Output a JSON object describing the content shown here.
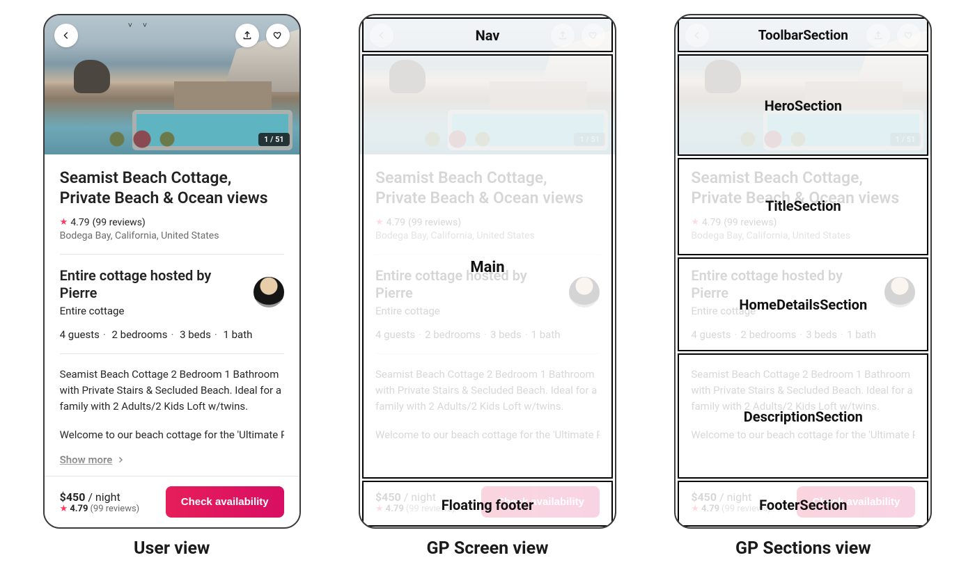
{
  "captions": {
    "user": "User view",
    "screen": "GP Screen view",
    "sections": "GP Sections view"
  },
  "hero": {
    "image_counter": "1 / 51"
  },
  "listing": {
    "title": "Seamist Beach Cottage, Private Beach & Ocean views",
    "rating": "4.79",
    "reviews": "(99 reviews)",
    "location": "Bodega Bay, California, United States"
  },
  "host": {
    "title": "Entire cottage hosted by Pierre",
    "subtitle": "Entire cottage"
  },
  "capacity": {
    "guests": "4 guests",
    "bedrooms": "2 bedrooms",
    "beds": "3 beds",
    "baths": "1 bath"
  },
  "description": {
    "p1": "Seamist Beach Cottage 2 Bedroom 1 Bathroom with Private Stairs & Secluded Beach. Ideal for a family with 2 Adults/2 Kids Loft w/twins.",
    "p2": "Welcome to our beach cottage for the 'Ultimate Pacific Coast Surf Experience'. Perched atop a cl…",
    "show_more": "Show more"
  },
  "footer": {
    "price": "$450",
    "per": "/ night",
    "rating": "4.79",
    "reviews": "(99 reviews)",
    "cta": "Check availability"
  },
  "overlays": {
    "screen": {
      "nav": "Nav",
      "main": "Main",
      "footer": "Floating footer"
    },
    "sections": {
      "toolbar": "ToolbarSection",
      "hero": "HeroSection",
      "title": "TitleSection",
      "home": "HomeDetailsSection",
      "desc": "DescriptionSection",
      "footer": "FooterSection"
    }
  }
}
